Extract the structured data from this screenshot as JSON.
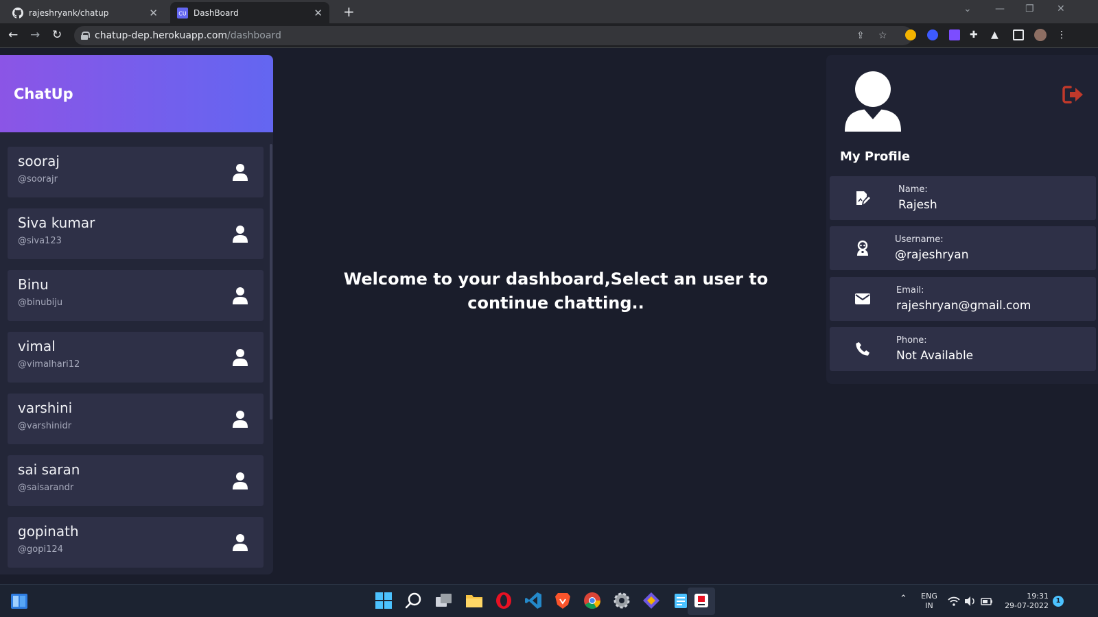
{
  "browser": {
    "tabs": [
      {
        "label": "rajeshryank/chatup",
        "icon": "github-icon",
        "active": false
      },
      {
        "label": "DashBoard",
        "icon": "cu-favicon-icon",
        "favicon_text": "CU",
        "active": true
      }
    ],
    "url_host": "chatup-dep.herokuapp.com",
    "url_path": "/dashboard"
  },
  "app": {
    "brand": "ChatUp",
    "brand_gradient": [
      "#8b55e6",
      "#6366f1"
    ],
    "users": [
      {
        "name": "sooraj",
        "handle": "@soorajr"
      },
      {
        "name": "Siva kumar",
        "handle": "@siva123"
      },
      {
        "name": "Binu",
        "handle": "@binubiju"
      },
      {
        "name": "vimal",
        "handle": "@vimalhari12"
      },
      {
        "name": "varshini",
        "handle": "@varshinidr"
      },
      {
        "name": "sai saran",
        "handle": "@saisarandr"
      },
      {
        "name": "gopinath",
        "handle": "@gopi124"
      }
    ],
    "welcome_message": "Welcome to your dashboard,Select an user to continue chatting..",
    "profile": {
      "title": "My Profile",
      "logout_color": "#c0392b",
      "fields": [
        {
          "label": "Name:",
          "value": "Rajesh",
          "icon": "edit-document-icon"
        },
        {
          "label": "Username:",
          "value": "@rajeshryan",
          "icon": "user-badge-icon"
        },
        {
          "label": "Email:",
          "value": "rajeshryan@gmail.com",
          "icon": "envelope-icon"
        },
        {
          "label": "Phone:",
          "value": "Not Available",
          "icon": "phone-icon"
        }
      ]
    }
  },
  "taskbar": {
    "language": "ENG",
    "region": "IN",
    "time": "19:31",
    "date": "29-07-2022",
    "notification_count": "1"
  }
}
